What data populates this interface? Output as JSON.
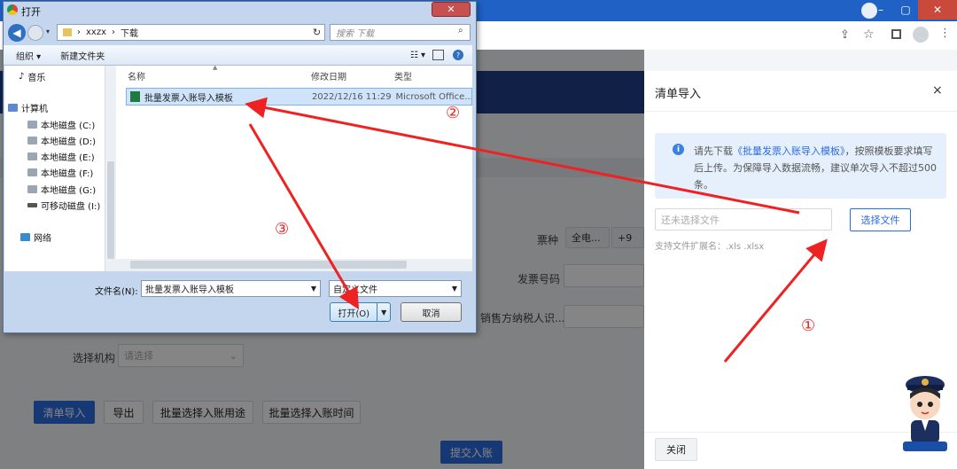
{
  "dialog": {
    "title": "打开",
    "close_label": "✕",
    "address": {
      "root": "xxzx",
      "folder": "下载"
    },
    "search_placeholder": "搜索 下载",
    "commands": {
      "organize": "组织 ▾",
      "new_folder": "新建文件夹"
    },
    "sidebar": [
      {
        "label": "音乐",
        "icon": "music-icon"
      },
      {
        "label": "计算机",
        "icon": "computer-icon"
      },
      {
        "label": "本地磁盘 (C:)",
        "icon": "disk-icon"
      },
      {
        "label": "本地磁盘 (D:)",
        "icon": "disk-icon"
      },
      {
        "label": "本地磁盘 (E:)",
        "icon": "disk-icon"
      },
      {
        "label": "本地磁盘 (F:)",
        "icon": "disk-icon"
      },
      {
        "label": "本地磁盘 (G:)",
        "icon": "disk-icon"
      },
      {
        "label": "可移动磁盘 (I:)",
        "icon": "usb-drive-icon"
      },
      {
        "label": "网络",
        "icon": "network-icon"
      }
    ],
    "columns": {
      "name": "名称",
      "modified": "修改日期",
      "type": "类型"
    },
    "file": {
      "name": "批量发票入账导入模板",
      "modified": "2022/12/16 11:29",
      "type": "Microsoft Office..."
    },
    "filename_label": "文件名(N):",
    "filename_value": "批量发票入账导入模板",
    "filter_value": "自定义文件",
    "open_label": "打开(O)",
    "cancel_label": "取消"
  },
  "page": {
    "labels": {
      "invoice_type": "票种",
      "invoice_no": "发票号码",
      "seller_tax": "销售方纳税人识...",
      "org": "选择机构"
    },
    "invoice_type_value": "全电...",
    "invoice_type_more": "+9",
    "org_placeholder": "请选择",
    "buttons": {
      "import": "清单导入",
      "export": "导出",
      "batch_use": "批量选择入账用途",
      "batch_time": "批量选择入账时间",
      "submit": "提交入账"
    }
  },
  "drawer": {
    "title": "清单导入",
    "close_label": "×",
    "notice_prefix": "请先下载",
    "notice_link": "《批量发票入账导入模板》",
    "notice_suffix": "，按照模板要求填写后上传。为保障导入数据流畅，建议单次导入不超过500条。",
    "file_placeholder": "还未选择文件",
    "select_button": "选择文件",
    "ext_hint": "支持文件扩展名：.xls .xlsx",
    "close_button": "关闭"
  },
  "annotations": {
    "one": "①",
    "two": "②",
    "three": "③"
  },
  "colors": {
    "arrow": "#ee2222",
    "primary": "#2b6ce0",
    "header": "#1f3f86"
  }
}
